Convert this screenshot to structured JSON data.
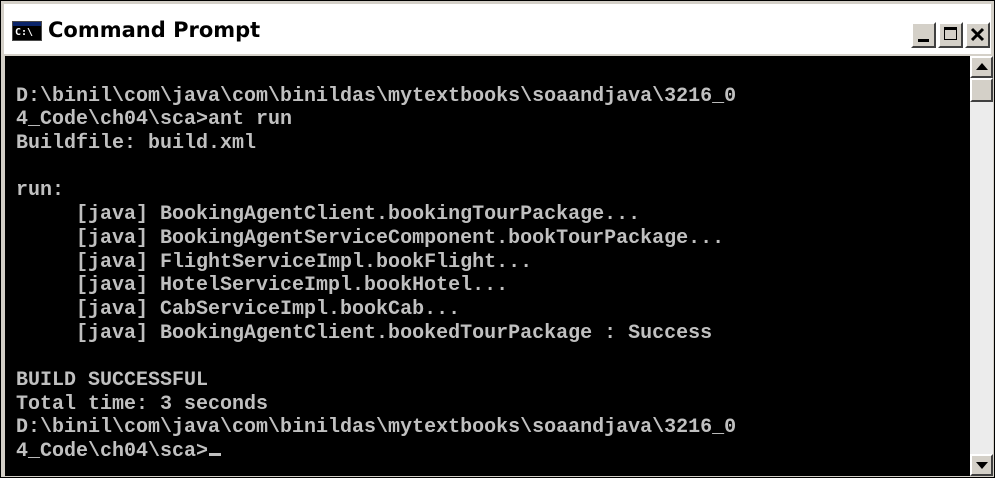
{
  "window": {
    "title": "Command Prompt",
    "icon_label": "C:\\"
  },
  "colors": {
    "console_background": "#000000",
    "console_text": "#c0c0c0",
    "titlebar_background": "#ffffff",
    "chrome": "#d4d0c8"
  },
  "icons": {
    "window_icon": "command-prompt-icon",
    "minimize": "minimize-icon",
    "maximize": "maximize-icon",
    "close": "close-icon",
    "scroll_up": "arrow-up-icon",
    "scroll_down": "arrow-down-icon"
  },
  "console": {
    "lines": [
      "",
      "D:\\binil\\com\\java\\com\\binildas\\mytextbooks\\soaandjava\\3216_0",
      "4_Code\\ch04\\sca>ant run",
      "Buildfile: build.xml",
      "",
      "run:",
      "     [java] BookingAgentClient.bookingTourPackage...",
      "     [java] BookingAgentServiceComponent.bookTourPackage...",
      "     [java] FlightServiceImpl.bookFlight...",
      "     [java] HotelServiceImpl.bookHotel...",
      "     [java] CabServiceImpl.bookCab...",
      "     [java] BookingAgentClient.bookedTourPackage : Success",
      "",
      "BUILD SUCCESSFUL",
      "Total time: 3 seconds",
      "D:\\binil\\com\\java\\com\\binildas\\mytextbooks\\soaandjava\\3216_0",
      "4_Code\\ch04\\sca>"
    ]
  }
}
